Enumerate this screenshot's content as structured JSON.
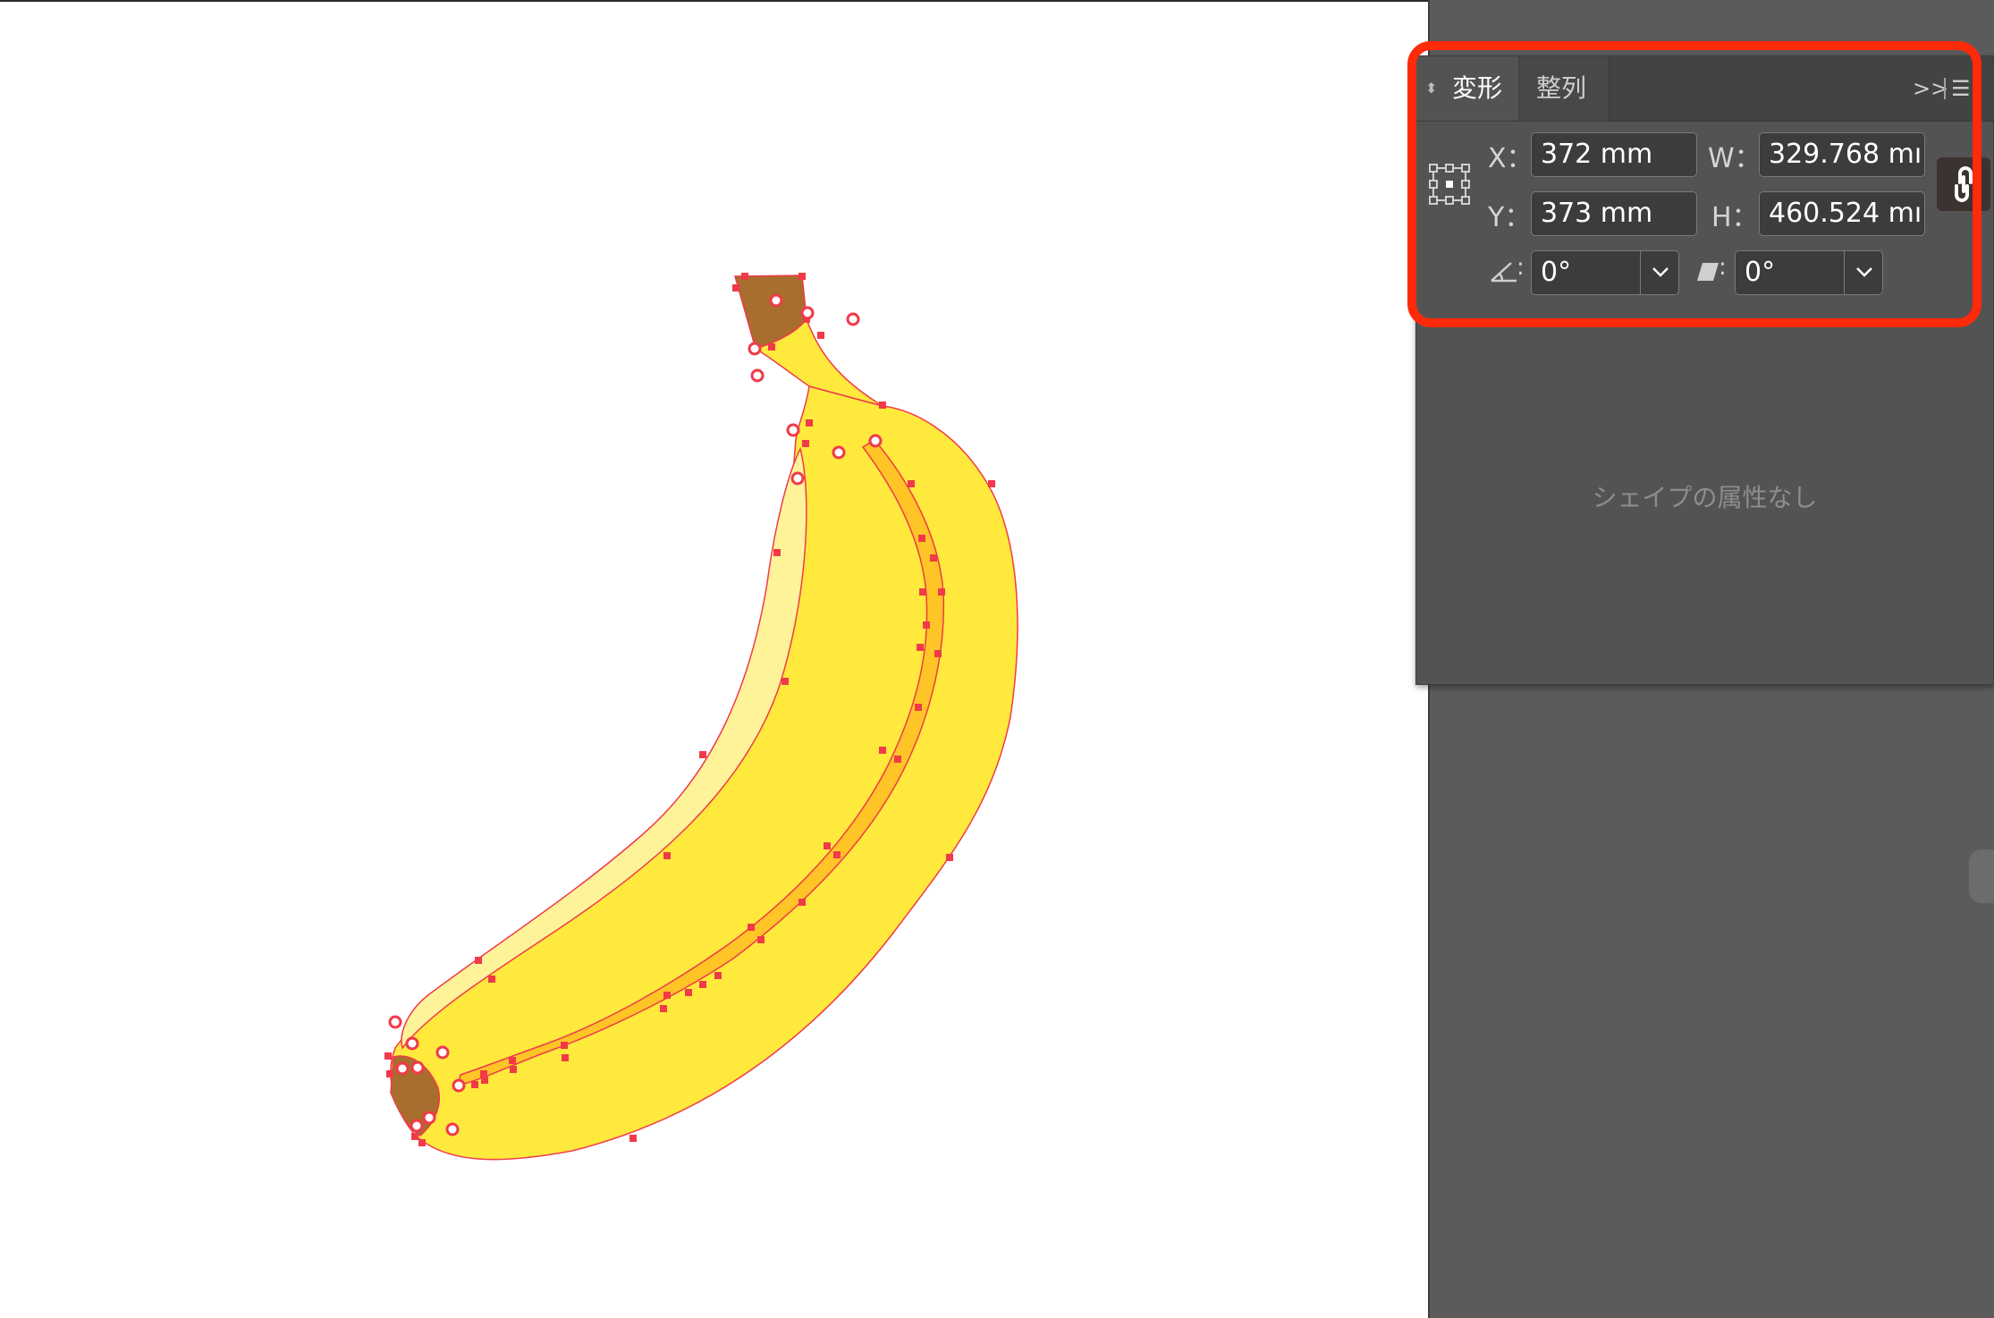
{
  "panel": {
    "tabs": [
      {
        "label": "変形",
        "active": true
      },
      {
        "label": "整列",
        "active": false
      }
    ],
    "expand_icon": "double-chevron-right-icon",
    "menu_icon": "hamburger-menu-icon",
    "fields": {
      "x": {
        "label": "X：",
        "value": "372 mm"
      },
      "y": {
        "label": "Y：",
        "value": "373 mm"
      },
      "w": {
        "label": "W：",
        "value": "329.768 mı"
      },
      "h": {
        "label": "H：",
        "value": "460.524 mı"
      },
      "rotate": {
        "icon": "rotate-angle-icon",
        "value": "0°"
      },
      "shear": {
        "icon": "shear-icon",
        "value": "0°"
      }
    },
    "link_icon": "chain-link-icon",
    "reference_point_icon": "reference-point-grid-icon",
    "no_shape_message": "シェイプの属性なし"
  },
  "colors": {
    "highlight": "#ff2a0a",
    "banana_body": "#ffe93c",
    "banana_highlight": "#fff39a",
    "banana_ridge": "#ffc526",
    "banana_stem": "#a86e2d",
    "anchor_point": "#f03a4a"
  }
}
